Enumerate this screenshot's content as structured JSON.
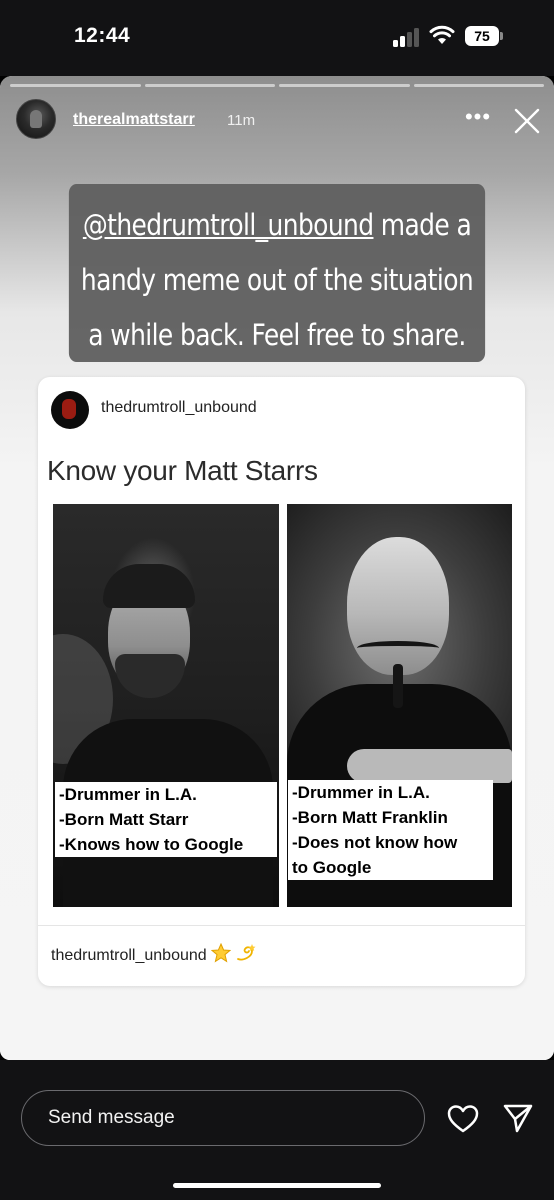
{
  "status_bar": {
    "time": "12:44",
    "battery": "75",
    "icons": [
      "signal-icon",
      "wifi-icon",
      "battery-icon"
    ]
  },
  "story": {
    "segments": 4,
    "username": "therealmattstarr",
    "time_ago": "11m",
    "more_icon": "more-horizontal-icon",
    "close_icon": "close-icon",
    "caption_mention": "@thedrumtroll_unbound",
    "caption_rest": " made a handy meme out of the situation a while back. Feel free to share.",
    "post": {
      "username": "thedrumtroll_unbound",
      "title": "Know your Matt Starrs",
      "left_caption": [
        "-Drummer in L.A.",
        "-Born Matt Starr",
        "-Knows how to Google"
      ],
      "right_caption": [
        "-Drummer in L.A.",
        "-Born Matt Franklin",
        "-Does not know how",
        "to Google"
      ],
      "footer_username": "thedrumtroll_unbound",
      "footer_icons": [
        "star-icon",
        "dizzy-icon"
      ]
    }
  },
  "bottom_bar": {
    "message_placeholder": "Send message",
    "icons": [
      "heart-icon",
      "send-icon"
    ]
  }
}
